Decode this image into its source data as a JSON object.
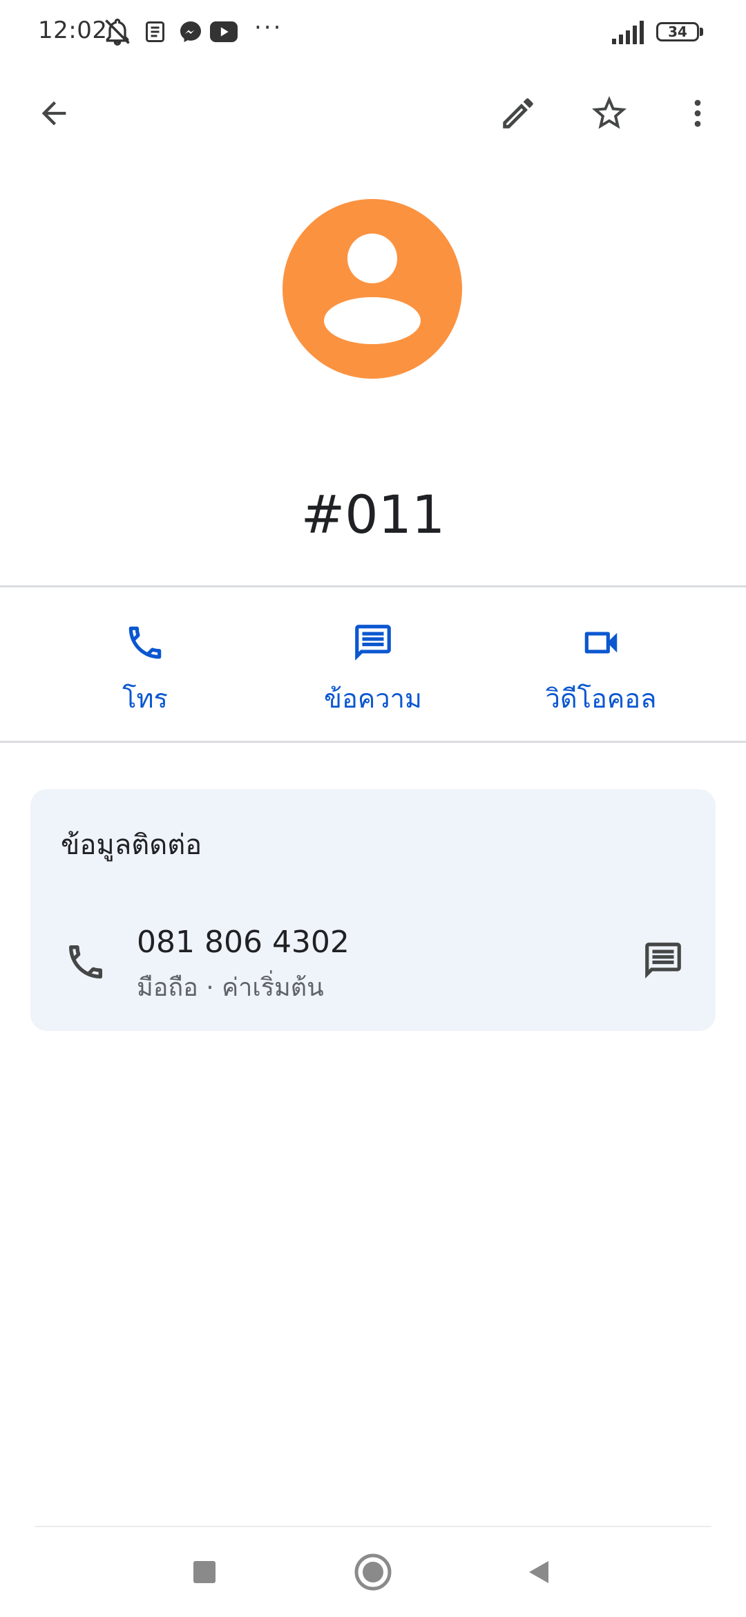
{
  "status_bar": {
    "time": "12:02",
    "more": "···",
    "battery": "34",
    "icons": [
      "mute-vibrate-icon",
      "news-icon",
      "messenger-icon",
      "youtube-icon",
      "signal-icon",
      "battery-icon"
    ]
  },
  "top_bar": {
    "icons": [
      "back-arrow-icon",
      "edit-pencil-icon",
      "star-outline-icon",
      "more-vert-icon"
    ]
  },
  "contact": {
    "name": "#011",
    "avatar_color": "#fb9240"
  },
  "actions": [
    {
      "label": "โทร",
      "icon": "phone-icon"
    },
    {
      "label": "ข้อความ",
      "icon": "message-icon"
    },
    {
      "label": "วิดีโอคอล",
      "icon": "videocam-icon"
    }
  ],
  "contact_info": {
    "title": "ข้อมูลติดต่อ",
    "phone": "081 806 4302",
    "phone_detail": "มือถือ · ค่าเริ่มต้น"
  },
  "colors": {
    "accent": "#0b57d0",
    "card_bg": "#eff3fa",
    "icon": "#444746"
  },
  "nav_bar": {
    "icons": [
      "recents-square-icon",
      "home-circle-icon",
      "back-triangle-icon"
    ]
  }
}
